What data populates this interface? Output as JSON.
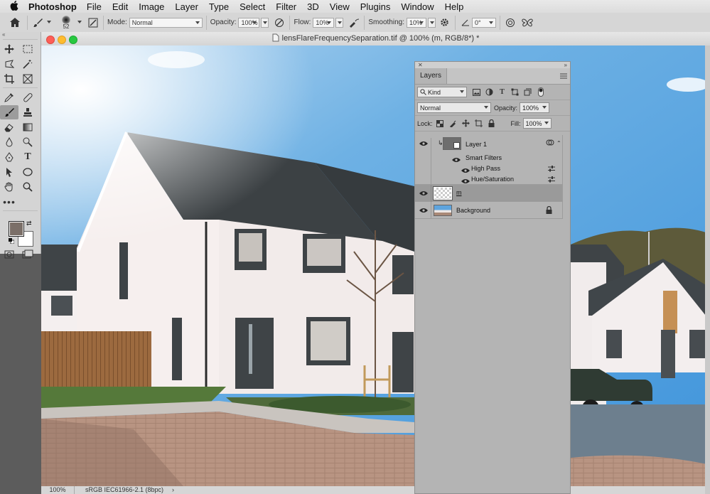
{
  "menubar": {
    "app_name": "Photoshop",
    "items": [
      "File",
      "Edit",
      "Image",
      "Layer",
      "Type",
      "Select",
      "Filter",
      "3D",
      "View",
      "Plugins",
      "Window",
      "Help"
    ]
  },
  "options_bar": {
    "brush_size": "52",
    "mode_label": "Mode:",
    "mode_value": "Normal",
    "opacity_label": "Opacity:",
    "opacity_value": "100%",
    "flow_label": "Flow:",
    "flow_value": "10%",
    "smoothing_label": "Smoothing:",
    "smoothing_value": "10%",
    "angle_value": "0°"
  },
  "document": {
    "title": "lensFlareFrequencySeparation.tif @ 100% (m, RGB/8*) *",
    "zoom": "100%",
    "color_profile": "sRGB IEC61966-2.1 (8bpc)"
  },
  "layers_panel": {
    "tab_label": "Layers",
    "filter_kind": "Kind",
    "blend_mode": "Normal",
    "opacity_label": "Opacity:",
    "opacity_value": "100%",
    "lock_label": "Lock:",
    "fill_label": "Fill:",
    "fill_value": "100%",
    "layers": [
      {
        "name": "Layer 1",
        "smart_filters_label": "Smart Filters",
        "filters": [
          "High Pass",
          "Hue/Saturation"
        ]
      },
      {
        "name": "m"
      },
      {
        "name": "Background"
      }
    ]
  },
  "colors": {
    "foreground": "#7b6f68",
    "background": "#ffffff",
    "panel_bg": "#b4b4b4",
    "selected_layer": "#9a9a9a"
  },
  "icons": {
    "close": "red-light",
    "minimize": "yellow-light",
    "zoom": "green-light"
  }
}
